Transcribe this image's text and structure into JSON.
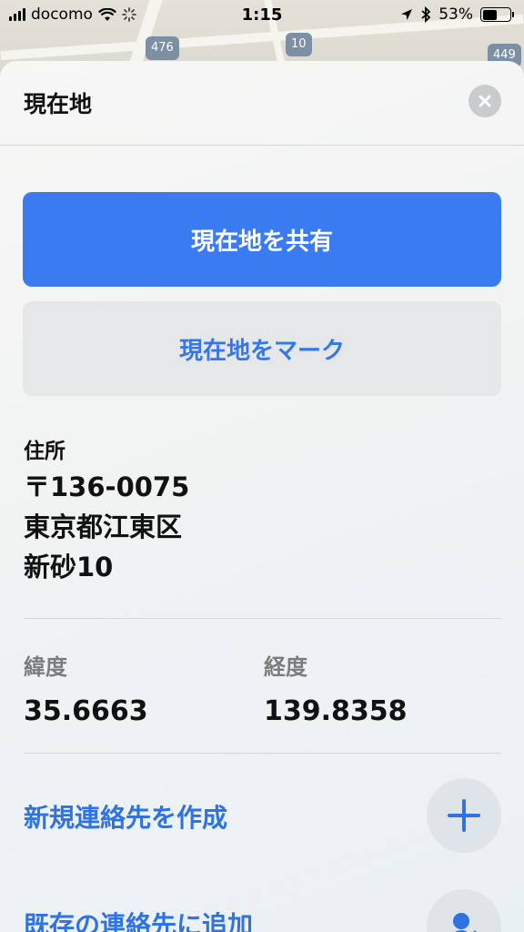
{
  "status_bar": {
    "carrier": "docomo",
    "time": "1:15",
    "battery": "53%",
    "battery_level": 0.53
  },
  "map": {
    "route_shields": [
      "476",
      "10",
      "449"
    ]
  },
  "sheet": {
    "title": "現在地",
    "share_button": "現在地を共有",
    "mark_button": "現在地をマーク",
    "address": {
      "label": "住所",
      "lines": [
        "〒136-0075",
        "東京都江東区",
        "新砂10"
      ]
    },
    "latitude": {
      "label": "緯度",
      "value": "35.6663"
    },
    "longitude": {
      "label": "経度",
      "value": "139.8358"
    },
    "actions": [
      {
        "label": "新規連絡先を作成",
        "icon": "plus-icon"
      },
      {
        "label": "既存の連絡先に追加",
        "icon": "add-contact-icon"
      }
    ]
  },
  "colors": {
    "accent": "#3a7bf1",
    "link": "#2f72e0"
  }
}
